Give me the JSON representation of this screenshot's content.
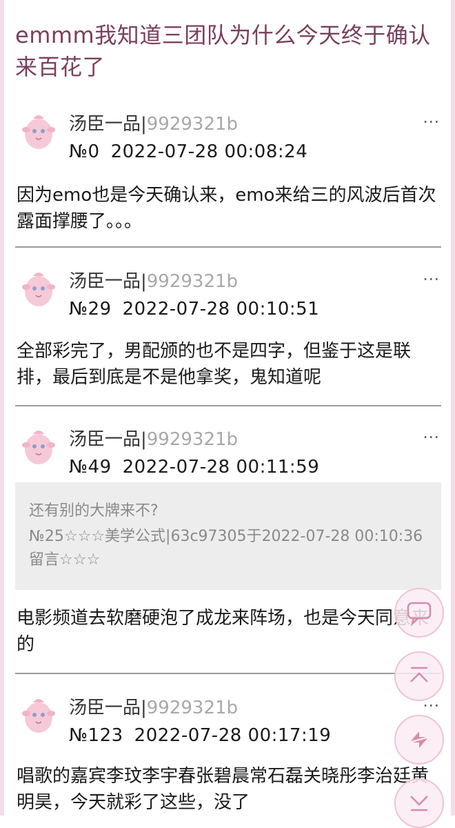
{
  "thread": {
    "title": "emmm我知道三团队为什么今天终于确认来百花了"
  },
  "posts": [
    {
      "author": "汤臣一品|",
      "uid": "9929321b",
      "floor": "№0",
      "time": "2022-07-28 00:08:24",
      "content": "因为emo也是今天确认来，emo来给三的风波后首次露面撑腰了。。。"
    },
    {
      "author": "汤臣一品|",
      "uid": "9929321b",
      "floor": "№29",
      "time": "2022-07-28 00:10:51",
      "content": "全部彩完了，男配颁的也不是四字，但鉴于这是联排，最后到底是不是他拿奖，鬼知道呢"
    },
    {
      "author": "汤臣一品|",
      "uid": "9929321b",
      "floor": "№49",
      "time": "2022-07-28 00:11:59",
      "quote": {
        "text": "还有别的大牌来不?",
        "meta": "№25☆☆☆美学公式|63c97305于2022-07-28 00:10:36留言☆☆☆"
      },
      "content": "电影频道去软磨硬泡了成龙来阵场，也是今天同意来的"
    },
    {
      "author": "汤臣一品|",
      "uid": "9929321b",
      "floor": "№123",
      "time": "2022-07-28 00:17:19",
      "content": "唱歌的嘉宾李玟李宇春张碧晨常石磊关晓彤李治廷黄明昊，今天就彩了这些，没了"
    }
  ],
  "more_icon": "⋯",
  "fabs": [
    "comment-icon",
    "scroll-top-icon",
    "refresh-icon",
    "scroll-bottom-icon"
  ],
  "colors": {
    "title": "#7a3f5e",
    "accent": "#f0c2d6",
    "uid": "#a8a8a8",
    "quote_bg": "#ededed"
  }
}
